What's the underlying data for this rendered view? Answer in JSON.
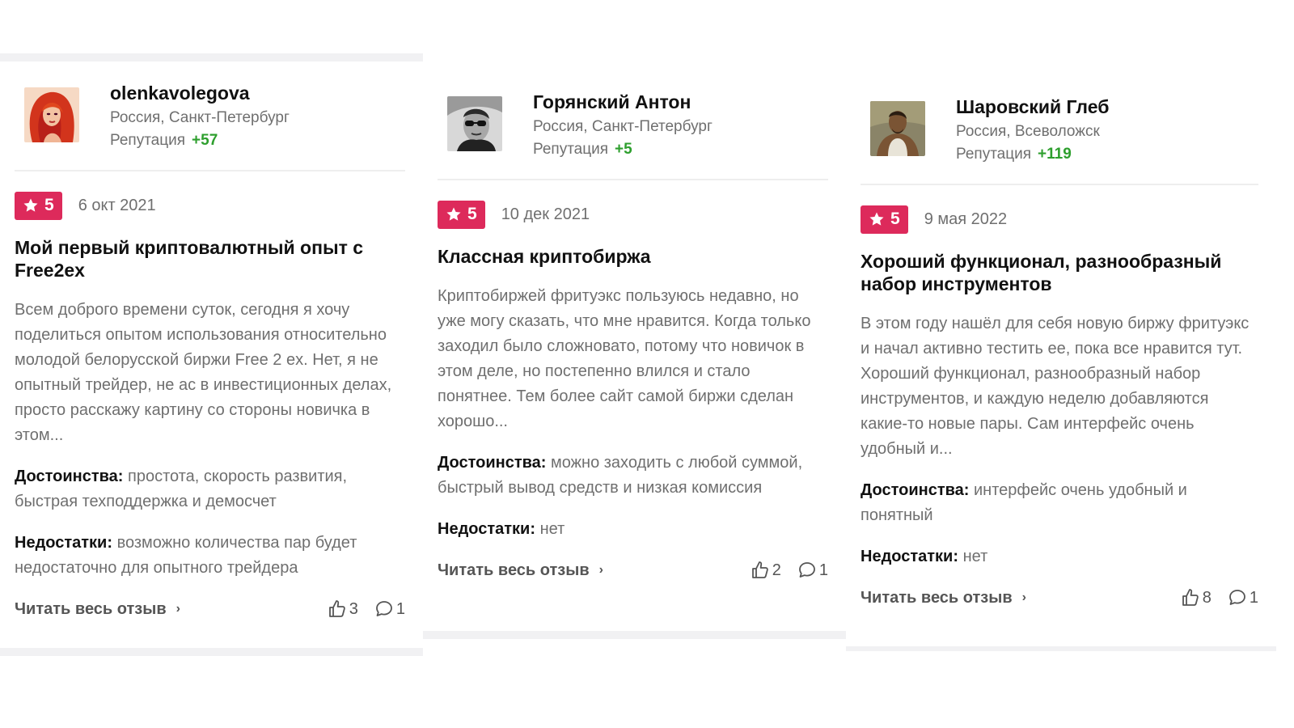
{
  "colors": {
    "rating_badge": "#dd2a5b",
    "reputation_positive": "#2e9f2e",
    "muted_text": "#6f6f6f",
    "card_band": "#f1f1f3"
  },
  "reviews": [
    {
      "author": {
        "name": "olenkavolegova",
        "location": "Россия, Санкт-Петербург",
        "reputation_label": "Репутация",
        "reputation_value": "+57",
        "avatar_icon": "red-haired-woman-avatar"
      },
      "rating": "5",
      "date": "6 окт 2021",
      "title": "Мой первый криптовалютный опыт с Free2ex",
      "text": "Всем доброго времени суток, сегодня я хочу поделиться опытом использования относительно молодой белорусской биржи Free 2 ex. Нет, я не опытный трейдер, не ас в инвестиционных делах, просто расскажу картину со стороны новичка в этом...",
      "pros_label": "Достоинства:",
      "pros": "простота, скорость развития, быстрая техподдержка и демосчет",
      "cons_label": "Недостатки:",
      "cons": "возможно количества пар будет недостаточно для опытного трейдера",
      "read_more": "Читать весь отзыв",
      "likes": "3",
      "comments": "1"
    },
    {
      "author": {
        "name": "Горянский Антон",
        "location": "Россия, Санкт-Петербург",
        "reputation_label": "Репутация",
        "reputation_value": "+5",
        "avatar_icon": "man-sunglasses-avatar"
      },
      "rating": "5",
      "date": "10 дек 2021",
      "title": "Классная криптобиржа",
      "text": "Криптобиржей фритуэкс пользуюсь недавно, но уже могу сказать, что мне нравится. Когда только заходил было сложновато, потому что новичок в этом деле, но постепенно влился и стало понятнее. Тем более сайт самой биржи сделан хорошо...",
      "pros_label": "Достоинства:",
      "pros": "можно заходить с любой суммой, быстрый вывод средств и низкая комиссия",
      "cons_label": "Недостатки:",
      "cons": "нет",
      "read_more": "Читать весь отзыв",
      "likes": "2",
      "comments": "1"
    },
    {
      "author": {
        "name": "Шаровский Глеб",
        "location": "Россия, Всеволожск",
        "reputation_label": "Репутация",
        "reputation_value": "+119",
        "avatar_icon": "man-tank-top-avatar"
      },
      "rating": "5",
      "date": "9 мая 2022",
      "title": "Хороший функционал, разнообразный набор инструментов",
      "text": "В этом году нашёл для себя новую биржу фритуэкс и начал активно тестить ее, пока все нравится тут. Хороший функционал, разнообразный набор инструментов, и каждую неделю добавляются какие-то новые пары. Сам интерфейс очень удобный и...",
      "pros_label": "Достоинства:",
      "pros": "интерфейс очень удобный и понятный",
      "cons_label": "Недостатки:",
      "cons": "нет",
      "read_more": "Читать весь отзыв",
      "likes": "8",
      "comments": "1"
    }
  ]
}
